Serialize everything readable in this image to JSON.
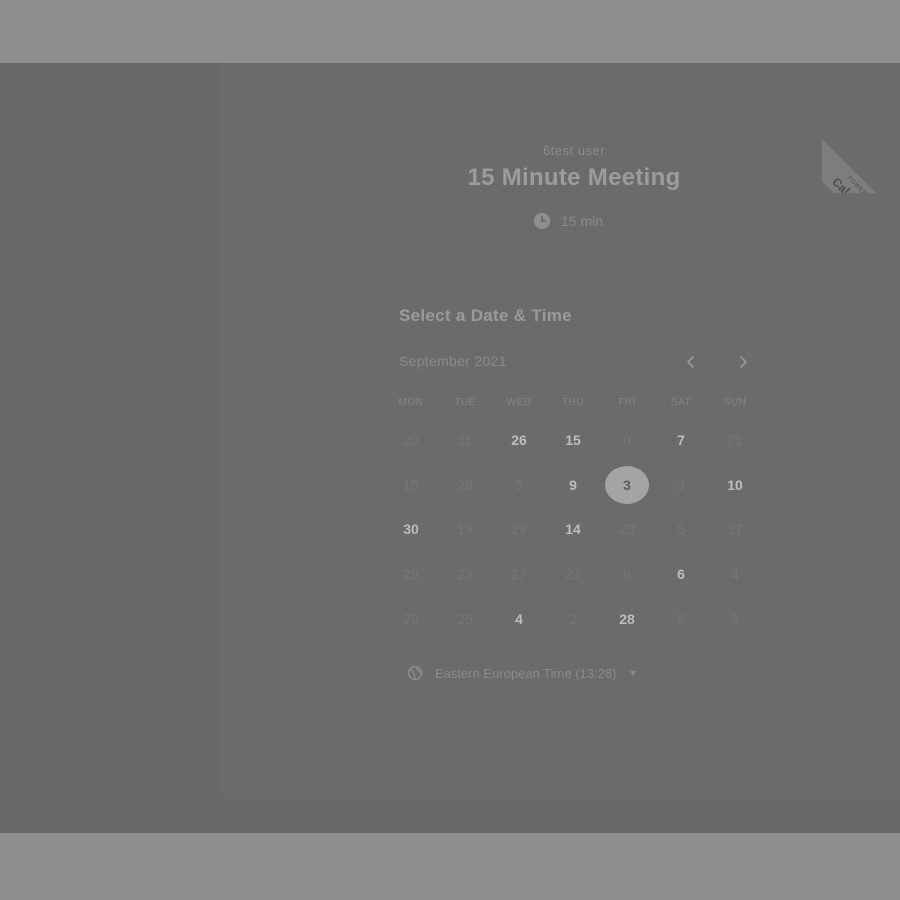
{
  "header": {
    "organizer": "6test user",
    "event_title": "15 Minute Meeting",
    "duration": "15 min"
  },
  "booking": {
    "section_title": "Select a Date & Time",
    "month_label": "September 2021",
    "weekdays": [
      "MON",
      "TUE",
      "WED",
      "THU",
      "FRI",
      "SAT",
      "SUN"
    ],
    "weeks": [
      [
        {
          "label": "20",
          "state": "disabled"
        },
        {
          "label": "11",
          "state": "disabled"
        },
        {
          "label": "26",
          "state": "available"
        },
        {
          "label": "15",
          "state": "available"
        },
        {
          "label": "0",
          "state": "disabled"
        },
        {
          "label": "7",
          "state": "available"
        },
        {
          "label": "21",
          "state": "disabled"
        }
      ],
      [
        {
          "label": "15",
          "state": "disabled"
        },
        {
          "label": "28",
          "state": "disabled"
        },
        {
          "label": "5",
          "state": "disabled"
        },
        {
          "label": "9",
          "state": "available"
        },
        {
          "label": "3",
          "state": "selected"
        },
        {
          "label": "3",
          "state": "disabled"
        },
        {
          "label": "10",
          "state": "available"
        }
      ],
      [
        {
          "label": "30",
          "state": "available"
        },
        {
          "label": "19",
          "state": "disabled"
        },
        {
          "label": "29",
          "state": "disabled"
        },
        {
          "label": "14",
          "state": "available"
        },
        {
          "label": "23",
          "state": "disabled"
        },
        {
          "label": "5",
          "state": "disabled"
        },
        {
          "label": "17",
          "state": "disabled"
        }
      ],
      [
        {
          "label": "29",
          "state": "disabled"
        },
        {
          "label": "23",
          "state": "disabled"
        },
        {
          "label": "27",
          "state": "disabled"
        },
        {
          "label": "27",
          "state": "disabled"
        },
        {
          "label": "9",
          "state": "disabled"
        },
        {
          "label": "6",
          "state": "available"
        },
        {
          "label": "4",
          "state": "disabled"
        }
      ],
      [
        {
          "label": "20",
          "state": "disabled"
        },
        {
          "label": "25",
          "state": "disabled"
        },
        {
          "label": "4",
          "state": "available"
        },
        {
          "label": "2",
          "state": "disabled"
        },
        {
          "label": "28",
          "state": "available"
        },
        {
          "label": "5",
          "state": "disabled"
        },
        {
          "label": "5",
          "state": "disabled"
        }
      ]
    ],
    "timezone": "Eastern European Time (13:28)"
  },
  "ribbon": {
    "small": "POWERED BY",
    "big": "Calendly"
  },
  "icons": {
    "clock": "clock-icon",
    "globe": "globe-icon",
    "prev": "chevron-left-icon",
    "next": "chevron-right-icon",
    "caret": "caret-down-icon"
  },
  "colors": {
    "selected_day_bg": "#a4a4a4",
    "overlay": "#696969",
    "band": "#8f8f8f"
  }
}
